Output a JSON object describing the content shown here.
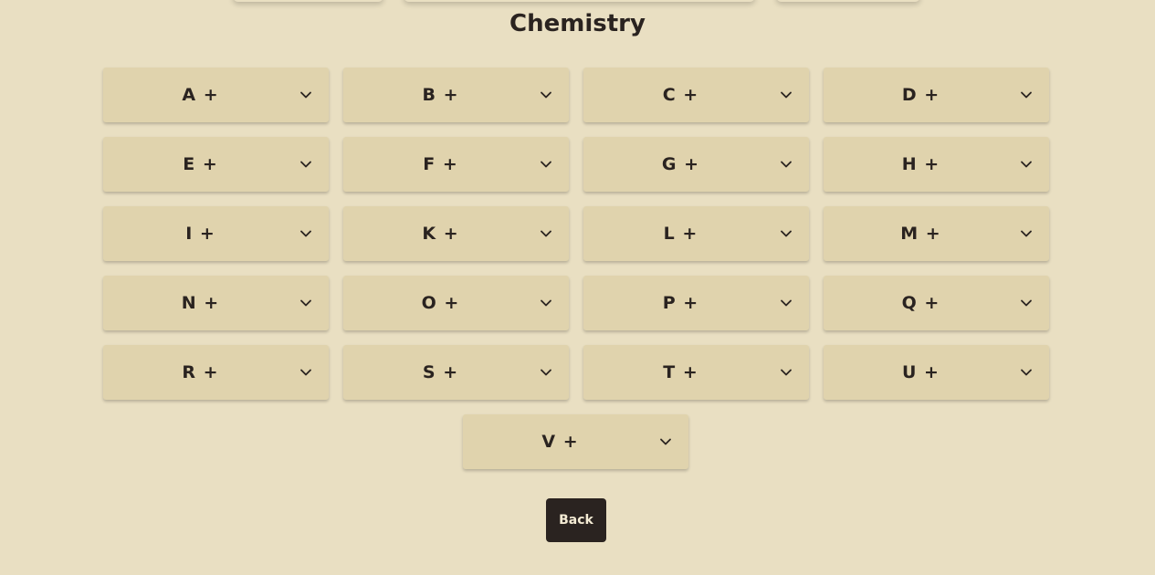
{
  "page": {
    "title": "Chemistry",
    "back_label": "Back"
  },
  "sections": [
    {
      "label": "A +"
    },
    {
      "label": "B +"
    },
    {
      "label": "C +"
    },
    {
      "label": "D +"
    },
    {
      "label": "E +"
    },
    {
      "label": "F +"
    },
    {
      "label": "G +"
    },
    {
      "label": "H +"
    },
    {
      "label": "I +"
    },
    {
      "label": "K +"
    },
    {
      "label": "L +"
    },
    {
      "label": "M +"
    },
    {
      "label": "N +"
    },
    {
      "label": "O +"
    },
    {
      "label": "P +"
    },
    {
      "label": "Q +"
    },
    {
      "label": "R +"
    },
    {
      "label": "S +"
    },
    {
      "label": "T +"
    },
    {
      "label": "U +"
    },
    {
      "label": "V +"
    }
  ],
  "icons": {
    "expand": "chevron-down-icon"
  },
  "colors": {
    "background": "#e9dfc2",
    "card": "#e0d3ad",
    "text": "#2a2320",
    "button": "#2a2320",
    "button_text": "#f3ead3"
  }
}
